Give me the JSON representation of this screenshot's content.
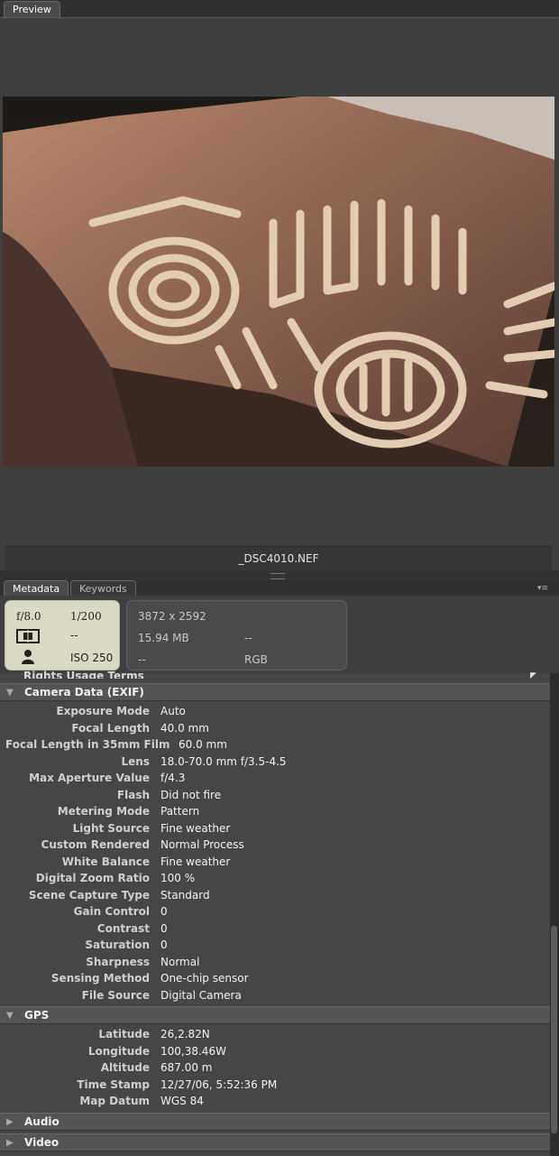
{
  "preview": {
    "tab_label": "Preview",
    "filename": "_DSC4010.NEF"
  },
  "metadata_panel": {
    "tabs": [
      {
        "label": "Metadata",
        "active": true
      },
      {
        "label": "Keywords",
        "active": false
      }
    ],
    "camera_summary": {
      "aperture": "f/8.0",
      "shutter": "1/200",
      "metering": "--",
      "iso": "ISO 250"
    },
    "file_summary": {
      "dimensions": "3872 x 2592",
      "size": "15.94 MB",
      "size_right": "--",
      "bottom_left": "--",
      "color_mode": "RGB"
    },
    "cutoff_label": "Rights Usage Terms",
    "sections": [
      {
        "title": "Camera Data (EXIF)",
        "expanded": true,
        "rows": [
          {
            "label": "Exposure Mode",
            "value": "Auto"
          },
          {
            "label": "Focal Length",
            "value": "40.0 mm"
          },
          {
            "label": "Focal Length in 35mm Film",
            "value": "60.0 mm"
          },
          {
            "label": "Lens",
            "value": "18.0-70.0 mm f/3.5-4.5"
          },
          {
            "label": "Max Aperture Value",
            "value": "f/4.3"
          },
          {
            "label": "Flash",
            "value": "Did not fire"
          },
          {
            "label": "Metering Mode",
            "value": "Pattern"
          },
          {
            "label": "Light Source",
            "value": "Fine weather"
          },
          {
            "label": "Custom Rendered",
            "value": "Normal Process"
          },
          {
            "label": "White Balance",
            "value": "Fine weather"
          },
          {
            "label": "Digital Zoom Ratio",
            "value": "100 %"
          },
          {
            "label": "Scene Capture Type",
            "value": "Standard"
          },
          {
            "label": "Gain Control",
            "value": "0"
          },
          {
            "label": "Contrast",
            "value": "0"
          },
          {
            "label": "Saturation",
            "value": "0"
          },
          {
            "label": "Sharpness",
            "value": "Normal"
          },
          {
            "label": "Sensing Method",
            "value": "One-chip sensor"
          },
          {
            "label": "File Source",
            "value": "Digital Camera"
          }
        ]
      },
      {
        "title": "GPS",
        "expanded": true,
        "rows": [
          {
            "label": "Latitude",
            "value": "26,2.82N"
          },
          {
            "label": "Longitude",
            "value": "100,38.46W"
          },
          {
            "label": "Altitude",
            "value": "687.00 m"
          },
          {
            "label": "Time Stamp",
            "value": "12/27/06, 5:52:36 PM"
          },
          {
            "label": "Map Datum",
            "value": "WGS 84"
          }
        ]
      },
      {
        "title": "Audio",
        "expanded": false,
        "rows": []
      },
      {
        "title": "Video",
        "expanded": false,
        "rows": []
      }
    ]
  }
}
